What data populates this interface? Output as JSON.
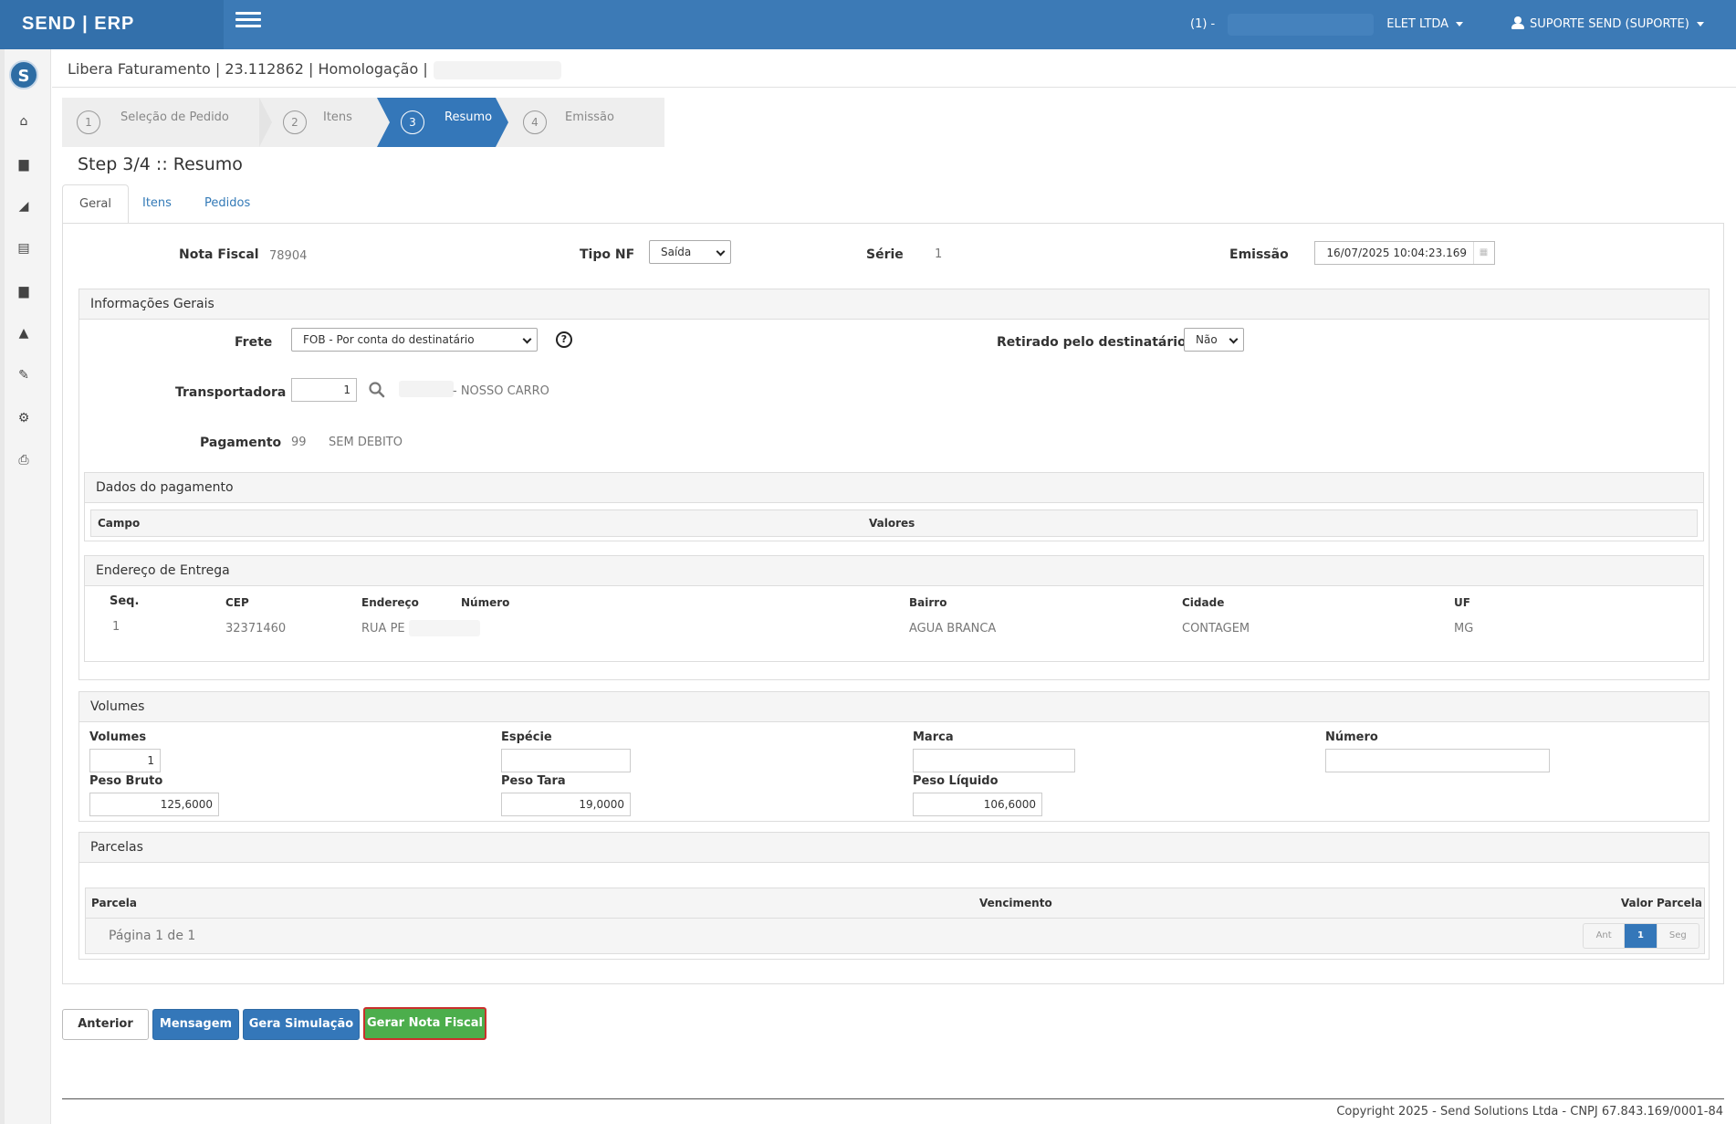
{
  "header": {
    "brand": "SEND | ERP",
    "company_prefix": "(1) -",
    "company_name": "ELET LTDA",
    "user": "SUPORTE SEND (SUPORTE)"
  },
  "sidebar": {
    "logo": "S",
    "items": [
      {
        "icon": "home-icon",
        "glyph": "⌂"
      },
      {
        "icon": "truck-icon",
        "glyph": "▆"
      },
      {
        "icon": "area-chart-icon",
        "glyph": "◢"
      },
      {
        "icon": "id-card-icon",
        "glyph": "▤"
      },
      {
        "icon": "truck-icon",
        "glyph": "▆"
      },
      {
        "icon": "road-icon",
        "glyph": "▲"
      },
      {
        "icon": "wrench-icon",
        "glyph": "✎"
      },
      {
        "icon": "cogs-icon",
        "glyph": "⚙"
      },
      {
        "icon": "print-icon",
        "glyph": "⎙"
      }
    ]
  },
  "breadcrumb": "Libera Faturamento | 23.112862 | Homologação |",
  "wizard": {
    "steps": [
      {
        "num": "1",
        "label": "Seleção de Pedido"
      },
      {
        "num": "2",
        "label": "Itens"
      },
      {
        "num": "3",
        "label": "Resumo"
      },
      {
        "num": "4",
        "label": "Emissão"
      }
    ],
    "active": 2
  },
  "step_title": "Step 3/4 :: Resumo",
  "tabs": [
    "Geral",
    "Itens",
    "Pedidos"
  ],
  "nota": {
    "nota_fiscal_label": "Nota Fiscal",
    "nota_fiscal_value": "78904",
    "tipo_nf_label": "Tipo NF",
    "tipo_nf_value": "Saída",
    "serie_label": "Série",
    "serie_value": "1",
    "emissao_label": "Emissão",
    "emissao_value": "16/07/2025 10:04:23.169"
  },
  "info_gerais": {
    "title": "Informações Gerais",
    "frete_label": "Frete",
    "frete_value": "FOB - Por conta do destinatário",
    "retirado_label": "Retirado pelo destinatário",
    "retirado_value": "Não",
    "transportadora_label": "Transportadora",
    "transportadora_code": "1",
    "transportadora_name": "- NOSSO CARRO",
    "pagamento_label": "Pagamento",
    "pagamento_code": "99",
    "pagamento_desc": "SEM DEBITO"
  },
  "dados_pagamento": {
    "title": "Dados do pagamento",
    "columns": [
      "Campo",
      "Valores"
    ]
  },
  "endereco": {
    "title": "Endereço de Entrega",
    "columns": [
      "Seq.",
      "CEP",
      "Endereço",
      "Número",
      "Bairro",
      "Cidade",
      "UF"
    ],
    "row": {
      "seq": "1",
      "cep": "32371460",
      "endereco": "RUA PE",
      "numero": "",
      "bairro": "AGUA BRANCA",
      "cidade": "CONTAGEM",
      "uf": "MG"
    }
  },
  "volumes": {
    "title": "Volumes",
    "volumes_label": "Volumes",
    "volumes_value": "1",
    "especie_label": "Espécie",
    "especie_value": "",
    "marca_label": "Marca",
    "marca_value": "",
    "numero_label": "Número",
    "numero_value": "",
    "peso_bruto_label": "Peso Bruto",
    "peso_bruto_value": "125,6000",
    "peso_tara_label": "Peso Tara",
    "peso_tara_value": "19,0000",
    "peso_liquido_label": "Peso Líquido",
    "peso_liquido_value": "106,6000"
  },
  "parcelas": {
    "title": "Parcelas",
    "columns": [
      "Parcela",
      "Vencimento",
      "Valor Parcela"
    ],
    "page_info": "Página 1 de 1",
    "pager": {
      "prev": "Ant",
      "current": "1",
      "next": "Seg"
    }
  },
  "buttons": {
    "anterior": "Anterior",
    "mensagem": "Mensagem",
    "gera_simulacao": "Gera Simulação",
    "gerar_nota": "Gerar Nota Fiscal"
  },
  "footer": "Copyright 2025 - Send Solutions Ltda - CNPJ 67.843.169/0001-84"
}
